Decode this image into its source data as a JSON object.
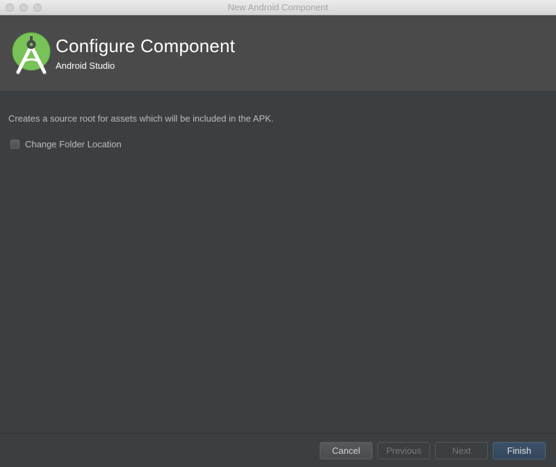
{
  "window": {
    "title": "New Android Component"
  },
  "header": {
    "title": "Configure Component",
    "subtitle": "Android Studio",
    "logo_icon": "android-studio-logo-icon"
  },
  "content": {
    "description": "Creates a source root for assets which will be included in the APK.",
    "change_folder_checkbox": {
      "label": "Change Folder Location",
      "checked": false
    }
  },
  "footer": {
    "buttons": {
      "cancel": "Cancel",
      "previous": "Previous",
      "next": "Next",
      "finish": "Finish"
    }
  },
  "colors": {
    "background": "#3c3f41",
    "header_background": "#4a4a4a",
    "logo_green": "#78c257",
    "primary_button": "#384c63"
  }
}
